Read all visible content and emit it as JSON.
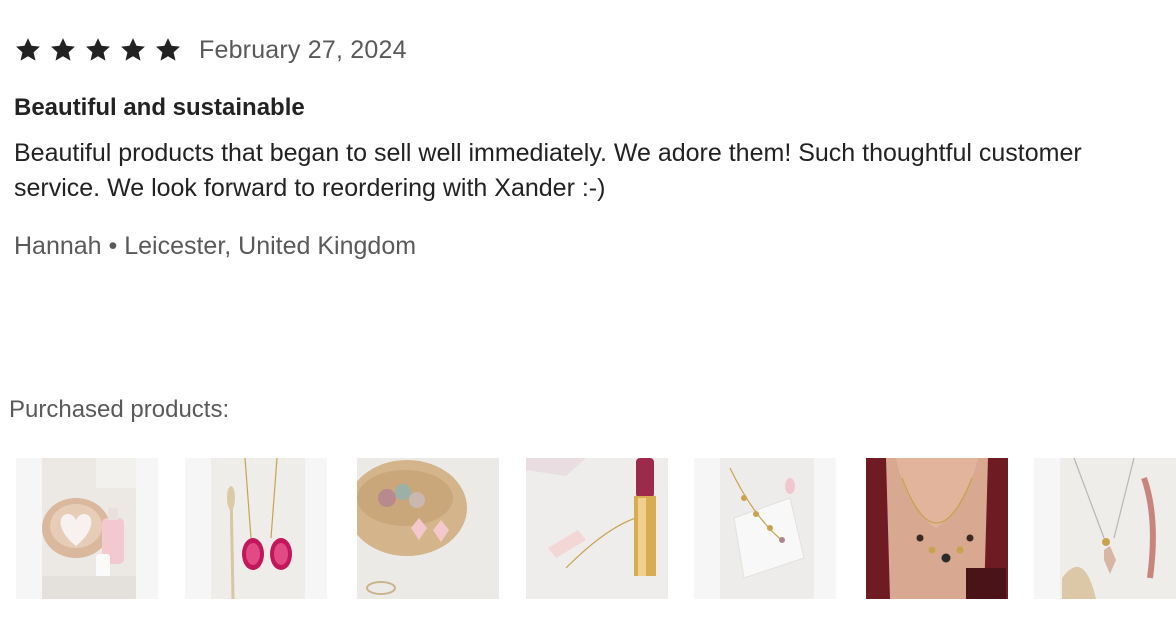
{
  "review": {
    "rating": 5,
    "rating_max": 5,
    "star_color": "#222222",
    "date": "February 27, 2024",
    "title": "Beautiful and sustainable",
    "body_line1": "Beautiful products that began to sell well immediately. We adore them! Such thoughtful customer",
    "body_line2": "service. We look forward to reordering with Xander :-)",
    "reviewer": "Hannah • Leicester, United Kingdom"
  },
  "purchased": {
    "label": "Purchased products:",
    "products": [
      {
        "image": "heart-soap-dish-product-image"
      },
      {
        "image": "pink-agate-pendant-product-image"
      },
      {
        "image": "crystal-earrings-bowl-product-image"
      },
      {
        "image": "rose-quartz-point-necklace-product-image"
      },
      {
        "image": "gold-charm-necklace-product-image"
      },
      {
        "image": "moon-charm-necklace-product-image"
      },
      {
        "image": "crystal-pendant-necklace-product-image"
      }
    ]
  }
}
